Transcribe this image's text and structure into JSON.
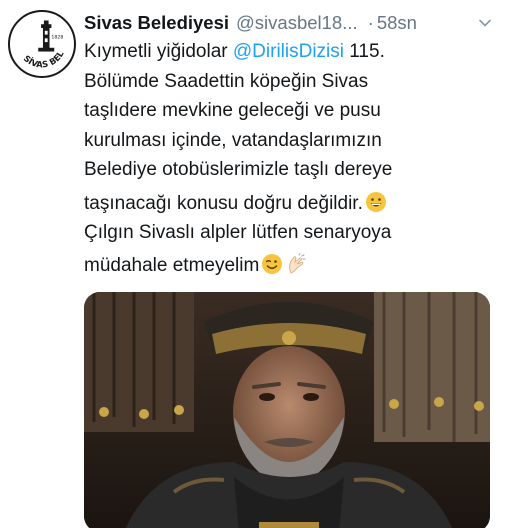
{
  "tweet": {
    "author_name": "Sivas Belediyesi",
    "handle": "@sivasbel18...",
    "separator": "·",
    "time": "58sn",
    "lines": [
      {
        "pre": "Kıymetli yiğidolar ",
        "mention": "@DirilisDizisi",
        "post": " 115."
      },
      {
        "text": "Bölümde Saadettin köpeğin Sivas"
      },
      {
        "text": "taşlıdere mevkine geleceği ve pusu"
      },
      {
        "text": "kurulması içinde, vatandaşlarımızın"
      },
      {
        "text": "Belediye otobüslerimizle taşlı dereye"
      },
      {
        "text": "taşınacağı konusu doğru değildir."
      },
      {
        "text": "Çılgın Sivaslı alpler lütfen senaryoya"
      },
      {
        "text": "müdahale etmeyelim"
      }
    ],
    "emojis": [
      "grinning-face-emoji",
      "winking-face-emoji",
      "clapping-hands-emoji"
    ]
  },
  "avatar": {
    "seal_text": "SİVAS BELEDİYESİ",
    "year": "1828"
  },
  "colors": {
    "name": "#14171a",
    "secondary": "#657786",
    "mention": "#1da1f2"
  }
}
